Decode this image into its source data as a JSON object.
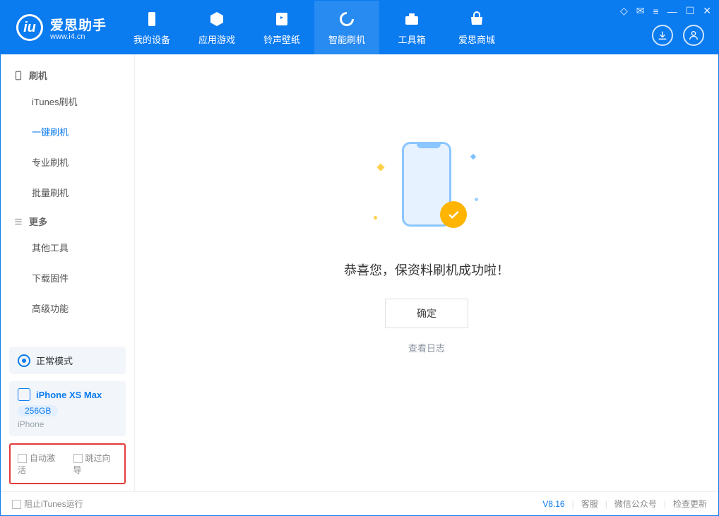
{
  "header": {
    "app_name": "爱思助手",
    "app_url": "www.i4.cn",
    "nav": [
      {
        "label": "我的设备"
      },
      {
        "label": "应用游戏"
      },
      {
        "label": "铃声壁纸"
      },
      {
        "label": "智能刷机"
      },
      {
        "label": "工具箱"
      },
      {
        "label": "爱思商城"
      }
    ]
  },
  "sidebar": {
    "section1": {
      "title": "刷机",
      "items": [
        "iTunes刷机",
        "一键刷机",
        "专业刷机",
        "批量刷机"
      ]
    },
    "section2": {
      "title": "更多",
      "items": [
        "其他工具",
        "下载固件",
        "高级功能"
      ]
    },
    "mode_label": "正常模式",
    "device": {
      "name": "iPhone XS Max",
      "storage": "256GB",
      "type": "iPhone"
    },
    "opt1": "自动激活",
    "opt2": "跳过向导"
  },
  "main": {
    "success_message": "恭喜您，保资料刷机成功啦！",
    "ok_button": "确定",
    "view_log": "查看日志"
  },
  "footer": {
    "block_itunes": "阻止iTunes运行",
    "version": "V8.16",
    "link1": "客服",
    "link2": "微信公众号",
    "link3": "检查更新"
  }
}
